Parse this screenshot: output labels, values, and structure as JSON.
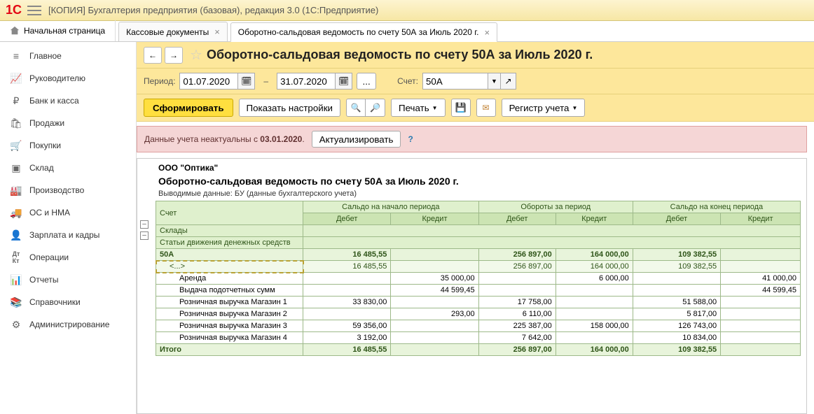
{
  "window_title": "[КОПИЯ] Бухгалтерия предприятия (базовая), редакция 3.0  (1С:Предприятие)",
  "tabs": {
    "home": "Начальная страница",
    "t1": "Кассовые документы",
    "t2": "Оборотно-сальдовая ведомость по счету 50А за Июль 2020 г."
  },
  "sidebar": [
    "Главное",
    "Руководителю",
    "Банк и касса",
    "Продажи",
    "Покупки",
    "Склад",
    "Производство",
    "ОС и НМА",
    "Зарплата и кадры",
    "Операции",
    "Отчеты",
    "Справочники",
    "Администрирование"
  ],
  "header": {
    "title": "Оборотно-сальдовая ведомость по счету 50А за Июль 2020 г."
  },
  "params": {
    "period_label": "Период:",
    "date_from": "01.07.2020",
    "date_to": "31.07.2020",
    "account_label": "Счет:",
    "account": "50А"
  },
  "toolbar": {
    "form": "Сформировать",
    "settings": "Показать настройки",
    "print": "Печать",
    "register": "Регистр учета"
  },
  "notice": {
    "text_prefix": "Данные учета неактуальны с ",
    "date": "03.01.2020",
    "dot": ".",
    "action": "Актуализировать"
  },
  "report": {
    "org": "ООО \"Оптика\"",
    "title": "Оборотно-сальдовая ведомость по счету 50А за Июль 2020 г.",
    "subtitle": "Выводимые данные:  БУ (данные бухгалтерского учета)",
    "headers": {
      "account": "Счет",
      "warehouses": "Склады",
      "articles": "Статьи движения денежных средств",
      "start": "Сальдо на начало периода",
      "turnover": "Обороты за период",
      "end": "Сальдо на конец периода",
      "debit": "Дебет",
      "credit": "Кредит",
      "total": "Итого"
    },
    "rows": [
      {
        "name": "50А",
        "sd": "16 485,55",
        "sc": "",
        "td": "256 897,00",
        "tc": "164 000,00",
        "ed": "109 382,55",
        "ec": ""
      },
      {
        "name": "<...>",
        "sd": "16 485,55",
        "sc": "",
        "td": "256 897,00",
        "tc": "164 000,00",
        "ed": "109 382,55",
        "ec": ""
      },
      {
        "name": "Аренда",
        "sd": "",
        "sc": "35 000,00",
        "td": "",
        "tc": "6 000,00",
        "ed": "",
        "ec": "41 000,00"
      },
      {
        "name": "Выдача подотчетных сумм",
        "sd": "",
        "sc": "44 599,45",
        "td": "",
        "tc": "",
        "ed": "",
        "ec": "44 599,45"
      },
      {
        "name": "Розничная выручка Магазин 1",
        "sd": "33 830,00",
        "sc": "",
        "td": "17 758,00",
        "tc": "",
        "ed": "51 588,00",
        "ec": ""
      },
      {
        "name": "Розничная выручка Магазин 2",
        "sd": "",
        "sc": "293,00",
        "td": "6 110,00",
        "tc": "",
        "ed": "5 817,00",
        "ec": ""
      },
      {
        "name": "Розничная выручка Магазин 3",
        "sd": "59 356,00",
        "sc": "",
        "td": "225 387,00",
        "tc": "158 000,00",
        "ed": "126 743,00",
        "ec": ""
      },
      {
        "name": "Розничная выручка Магазин 4",
        "sd": "3 192,00",
        "sc": "",
        "td": "7 642,00",
        "tc": "",
        "ed": "10 834,00",
        "ec": ""
      }
    ],
    "total": {
      "sd": "16 485,55",
      "sc": "",
      "td": "256 897,00",
      "tc": "164 000,00",
      "ed": "109 382,55",
      "ec": ""
    }
  }
}
